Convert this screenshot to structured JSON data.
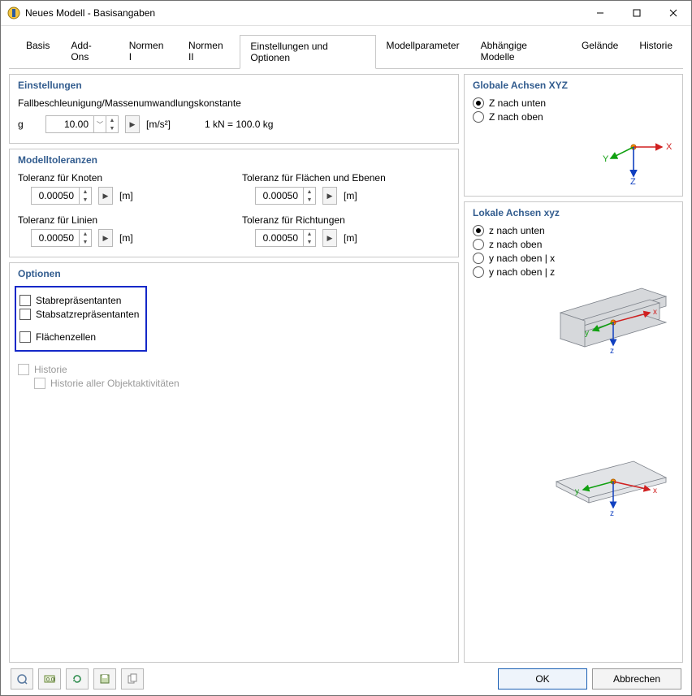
{
  "window": {
    "title": "Neues Modell - Basisangaben"
  },
  "tabs": [
    "Basis",
    "Add-Ons",
    "Normen I",
    "Normen II",
    "Einstellungen und Optionen",
    "Modellparameter",
    "Abhängige Modelle",
    "Gelände",
    "Historie"
  ],
  "activeTab": "Einstellungen und Optionen",
  "einstellungen": {
    "title": "Einstellungen",
    "line1": "Fallbeschleunigung/Massenumwandlungskonstante",
    "g_label": "g",
    "g_value": "10.00",
    "g_unit": "[m/s²]",
    "conv": "1 kN = 100.0 kg"
  },
  "modelltol": {
    "title": "Modelltoleranzen",
    "items": {
      "knoten": {
        "label": "Toleranz für Knoten",
        "value": "0.00050",
        "unit": "[m]"
      },
      "flaechen": {
        "label": "Toleranz für Flächen und Ebenen",
        "value": "0.00050",
        "unit": "[m]"
      },
      "linien": {
        "label": "Toleranz für Linien",
        "value": "0.00050",
        "unit": "[m]"
      },
      "richtungen": {
        "label": "Toleranz für Richtungen",
        "value": "0.00050",
        "unit": "[m]"
      }
    }
  },
  "optionen": {
    "title": "Optionen",
    "stabrep": "Stabrepräsentanten",
    "stabsatzrep": "Stabsatzrepräsentanten",
    "flaechenzellen": "Flächenzellen",
    "historie": "Historie",
    "historie_sub": "Historie aller Objektaktivitäten"
  },
  "global_axes": {
    "title": "Globale Achsen XYZ",
    "opts": [
      "Z nach unten",
      "Z nach oben"
    ],
    "selected": 0
  },
  "local_axes": {
    "title": "Lokale Achsen xyz",
    "opts": [
      "z nach unten",
      "z nach oben",
      "y nach oben | x",
      "y nach oben | z"
    ],
    "selected": 0
  },
  "footer": {
    "ok": "OK",
    "cancel": "Abbrechen"
  }
}
